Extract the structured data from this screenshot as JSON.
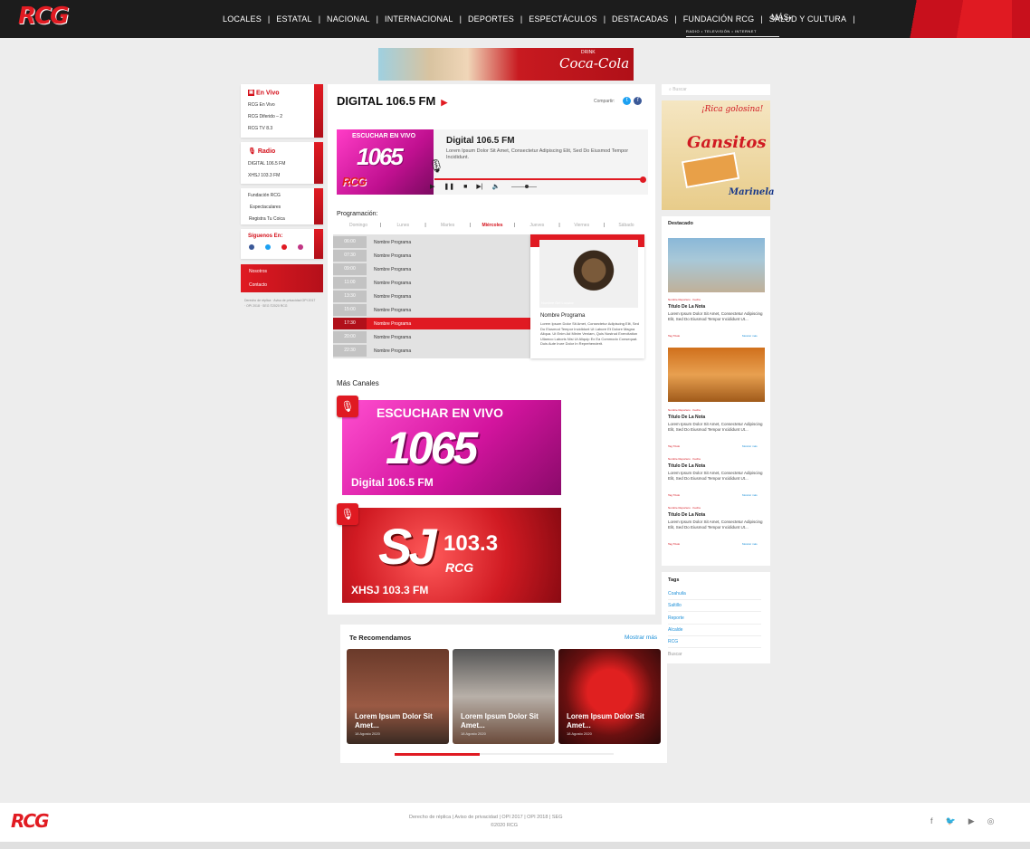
{
  "header": {
    "logo": "RCG",
    "logo_tagline": "RADIO • TELEVISIÓN • INTERNET",
    "nav": [
      "LOCALES",
      "ESTATAL",
      "NACIONAL",
      "INTERNACIONAL",
      "DEPORTES",
      "ESPECTÁCULOS",
      "DESTACADAS",
      "FUNDACIÓN RCG",
      "SALUD Y CULTURA"
    ],
    "more": "MÁS",
    "brand_red": "#e11b22"
  },
  "top_ad": {
    "text": "Coca-Cola",
    "drink": "DRINK"
  },
  "sidebar": {
    "envivo": {
      "title": "En Vivo",
      "links": [
        "RCG En Vivo",
        "RCG Diferido – 2",
        "RCG TV 8.3"
      ]
    },
    "radio": {
      "title": "Radio",
      "links": [
        "DIGITAL 106.5 FM",
        "XHSJ 103.3 FM"
      ]
    },
    "misc_links": [
      "Fundación RCG",
      "Espectaculares",
      "Registra Tu Coica"
    ],
    "siguenos": "Síguenos En:",
    "red_buttons": [
      "Nosotros",
      "Contacto"
    ],
    "footer_text": "Derecho de réplica · Aviso de privacidad OPI 2017 · OPI 2018 · SEG ©2020 RCG"
  },
  "station": {
    "title": "DIGITAL 106.5 FM",
    "share_label": "Compartir:",
    "player": {
      "art_escuchar": "ESCUCHAR EN VIVO",
      "art_num": "1065",
      "art_logo": "RCG",
      "title": "Digital 106.5 FM",
      "description": "Lorem Ipsum Dolor Sit Amet, Consectetur Adipiscing Elit, Sed Do Eiusmod Tempor Incididunt.",
      "progress": 1.0,
      "volume": 0.6
    }
  },
  "programacion": {
    "title": "Programación:",
    "days": [
      "Domingo",
      "Lunes",
      "Martes",
      "Miércoles",
      "Jueves",
      "Viernes",
      "Sábado"
    ],
    "active_day": "Miércoles",
    "rows": [
      {
        "time": "06:00",
        "name": "Nombre Programa"
      },
      {
        "time": "07:30",
        "name": "Nombre Programa"
      },
      {
        "time": "09:00",
        "name": "Nombre Programa"
      },
      {
        "time": "11:00",
        "name": "Nombre Programa"
      },
      {
        "time": "13:30",
        "name": "Nombre Programa"
      },
      {
        "time": "15:00",
        "name": "Nombre Programa"
      },
      {
        "time": "17:30",
        "name": "Nombre Programa"
      },
      {
        "time": "20:00",
        "name": "Nombre Programa"
      },
      {
        "time": "22:30",
        "name": "Nombre Programa"
      }
    ],
    "active_time": "17:30",
    "host": {
      "label": "Nombre Del Locutor",
      "program": "Nombre Programa",
      "description": "Lorem Ipsum Dolor Sit Amet, Consectetur Adipiscing Elit, Sed Do Eiusmod Tempor Incididunt Ut Labore Et Dolore Magna Aliqua. Ut Enim Ad Minim Veniam, Quis Nostrud Exercitation Ullamco Laboris Nisi Ut Aliquip Ex Ea Commodo Consequat. Duis Aute Irure Dolor In Reprehenderit."
    }
  },
  "mas_canales": {
    "title": "Más Canales",
    "channels": [
      {
        "escuchar": "ESCUCHAR EN VIVO",
        "art": "1065",
        "label": "Digital 106.5 FM"
      },
      {
        "art": "SJ",
        "art_sub": "103.3",
        "art_rcg": "RCG",
        "label": "XHSJ 103.3 FM"
      }
    ]
  },
  "recomendamos": {
    "title": "Te Recomendamos",
    "more": "Mostrar más",
    "cards": [
      {
        "title": "Lorem Ipsum Dolor Sit Amet...",
        "date": "18 Agosto 2020"
      },
      {
        "title": "Lorem Ipsum Dolor Sit Amet...",
        "date": "18 Agosto 2020"
      },
      {
        "title": "Lorem Ipsum Dolor Sit Amet...",
        "date": "18 Agosto 2020"
      }
    ],
    "carousel_progress": 0.39
  },
  "right": {
    "search_placeholder": "Buscar",
    "ad": {
      "line1": "¡Rica golosina!",
      "brand": "Gansitos",
      "maker": "Marinela"
    },
    "destacado": {
      "title": "Destacado",
      "items": [
        {
          "meta": "Nombre Reportero · Fecha",
          "title": "Título De La Nota",
          "text": "Lorem Ipsum Dolor Sit Amet, Consectetur Adipiscing Elit, Sed Do Eiusmod Tempor Incididunt Ut...",
          "tag": "Tag Título",
          "more": "Mostrar más"
        },
        {
          "meta": "Nombre Reportero · Fecha",
          "title": "Título De La Nota",
          "text": "Lorem Ipsum Dolor Sit Amet, Consectetur Adipiscing Elit, Sed Do Eiusmod Tempor Incididunt Ut...",
          "tag": "Tag Título",
          "more": "Mostrar más"
        },
        {
          "meta": "Nombre Reportero · Fecha",
          "title": "Título De La Nota",
          "text": "Lorem Ipsum Dolor Sit Amet, Consectetur Adipiscing Elit, Sed Do Eiusmod Tempor Incididunt Ut...",
          "tag": "Tag Título",
          "more": "Mostrar más"
        },
        {
          "meta": "Nombre Reportero · Fecha",
          "title": "Título De La Nota",
          "text": "Lorem Ipsum Dolor Sit Amet, Consectetur Adipiscing Elit, Sed Do Eiusmod Tempor Incididunt Ut...",
          "tag": "Tag Título",
          "more": "Mostrar más"
        }
      ]
    },
    "tags": {
      "title": "Tags",
      "items": [
        "Coahuila",
        "Saltillo",
        "Reporte",
        "Alcalde",
        "RCG",
        "Buscar"
      ]
    }
  },
  "footer": {
    "logo": "RCG",
    "links": "Derecho de réplica  |  Aviso de privacidad  |  OPI 2017  |  OPI 2018  |  SEG",
    "copyright": "©2020 RCG"
  }
}
